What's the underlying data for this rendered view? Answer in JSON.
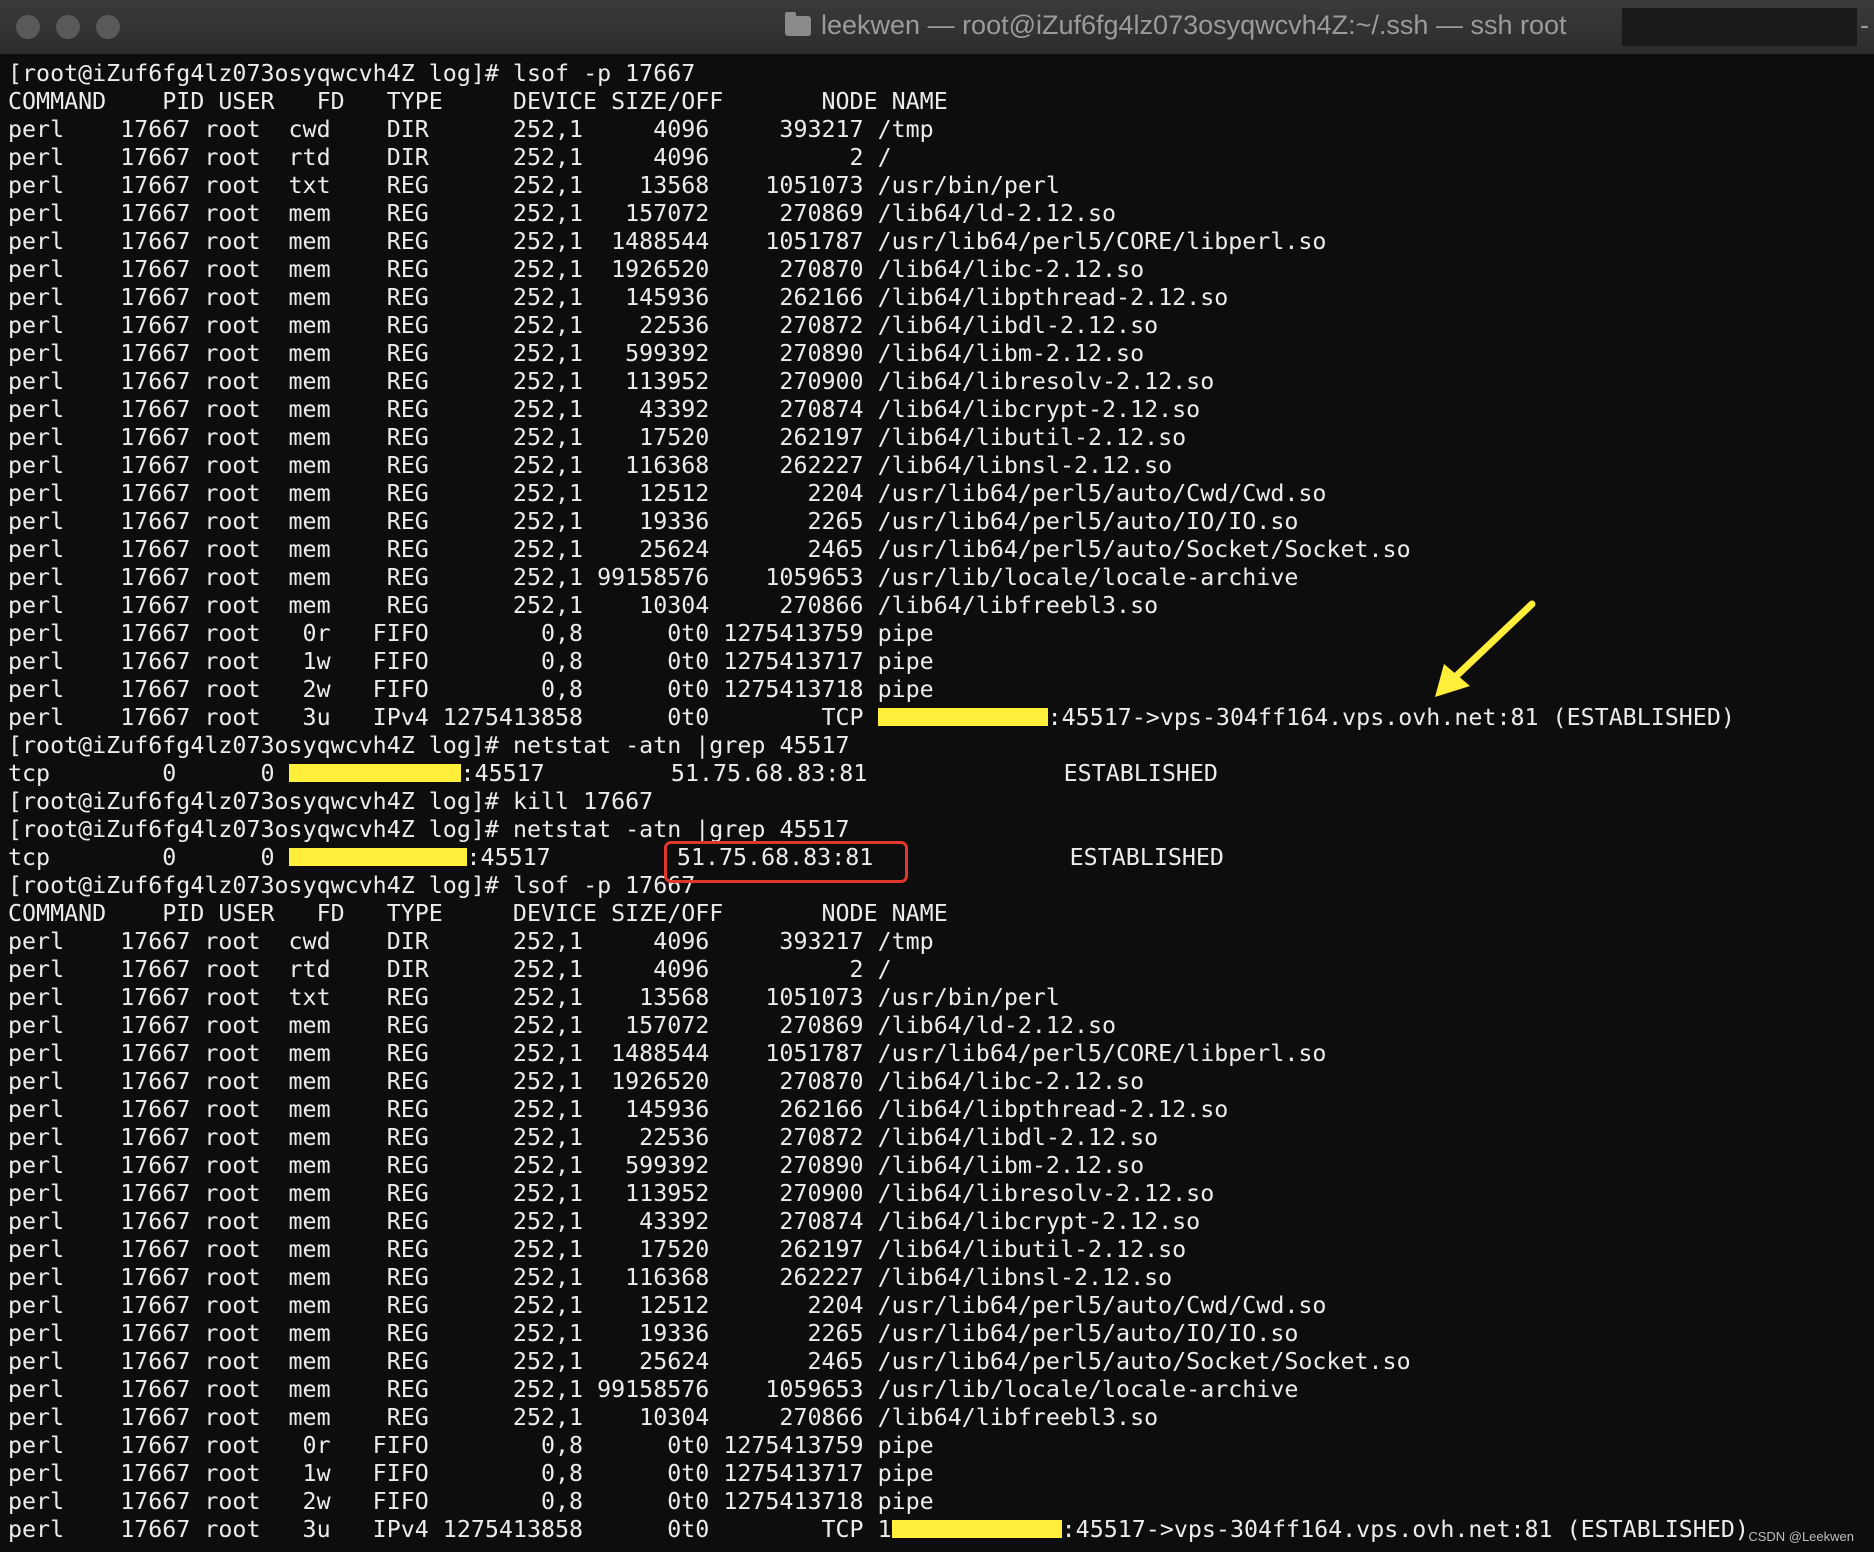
{
  "window": {
    "title": "leekwen — root@iZuf6fg4lz073osyqwcvh4Z:~/.ssh — ssh root",
    "title_trail": "-"
  },
  "colors": {
    "highlight": "#ffef3a",
    "annotation_box": "#e0372a",
    "arrow": "#ffef3a"
  },
  "icons": [
    "folder-icon",
    "arrow-icon"
  ],
  "terminal": {
    "prompt": "[root@iZuf6fg4lz073osyqwcvh4Z log]#",
    "block1": {
      "command": " lsof -p 17667",
      "header": "COMMAND    PID USER   FD   TYPE     DEVICE SIZE/OFF       NODE NAME",
      "rows": [
        "perl    17667 root  cwd    DIR      252,1     4096     393217 /tmp",
        "perl    17667 root  rtd    DIR      252,1     4096          2 /",
        "perl    17667 root  txt    REG      252,1    13568    1051073 /usr/bin/perl",
        "perl    17667 root  mem    REG      252,1   157072     270869 /lib64/ld-2.12.so",
        "perl    17667 root  mem    REG      252,1  1488544    1051787 /usr/lib64/perl5/CORE/libperl.so",
        "perl    17667 root  mem    REG      252,1  1926520     270870 /lib64/libc-2.12.so",
        "perl    17667 root  mem    REG      252,1   145936     262166 /lib64/libpthread-2.12.so",
        "perl    17667 root  mem    REG      252,1    22536     270872 /lib64/libdl-2.12.so",
        "perl    17667 root  mem    REG      252,1   599392     270890 /lib64/libm-2.12.so",
        "perl    17667 root  mem    REG      252,1   113952     270900 /lib64/libresolv-2.12.so",
        "perl    17667 root  mem    REG      252,1    43392     270874 /lib64/libcrypt-2.12.so",
        "perl    17667 root  mem    REG      252,1    17520     262197 /lib64/libutil-2.12.so",
        "perl    17667 root  mem    REG      252,1   116368     262227 /lib64/libnsl-2.12.so",
        "perl    17667 root  mem    REG      252,1    12512       2204 /usr/lib64/perl5/auto/Cwd/Cwd.so",
        "perl    17667 root  mem    REG      252,1    19336       2265 /usr/lib64/perl5/auto/IO/IO.so",
        "perl    17667 root  mem    REG      252,1    25624       2465 /usr/lib64/perl5/auto/Socket/Socket.so",
        "perl    17667 root  mem    REG      252,1 99158576    1059653 /usr/lib/locale/locale-archive",
        "perl    17667 root  mem    REG      252,1    10304     270866 /lib64/libfreebl3.so",
        "perl    17667 root   0r   FIFO        0,8      0t0 1275413759 pipe",
        "perl    17667 root   1w   FIFO        0,8      0t0 1275413717 pipe",
        "perl    17667 root   2w   FIFO        0,8      0t0 1275413718 pipe"
      ],
      "tcp_row_prefix": "perl    17667 root   3u   IPv4 1275413858      0t0        TCP ",
      "tcp_row_suffix": ":45517->vps-304ff164.vps.ovh.net:81 (ESTABLISHED)"
    },
    "netstat1": {
      "command": " netstat -atn |grep 45517",
      "prefix": "tcp        0      0 ",
      "suffix": ":45517         51.75.68.83:81              ESTABLISHED"
    },
    "kill": {
      "command": " kill 17667"
    },
    "netstat2": {
      "command": " netstat -atn |grep 45517",
      "prefix": "tcp        0      0 ",
      "port": ":45517",
      "gap": "         ",
      "foreign": "51.75.68.83:81",
      "state": "              ESTABLISHED"
    },
    "block2": {
      "command": " lsof -p 17667",
      "header": "COMMAND    PID USER   FD   TYPE     DEVICE SIZE/OFF       NODE NAME",
      "rows": [
        "perl    17667 root  cwd    DIR      252,1     4096     393217 /tmp",
        "perl    17667 root  rtd    DIR      252,1     4096          2 /",
        "perl    17667 root  txt    REG      252,1    13568    1051073 /usr/bin/perl",
        "perl    17667 root  mem    REG      252,1   157072     270869 /lib64/ld-2.12.so",
        "perl    17667 root  mem    REG      252,1  1488544    1051787 /usr/lib64/perl5/CORE/libperl.so",
        "perl    17667 root  mem    REG      252,1  1926520     270870 /lib64/libc-2.12.so",
        "perl    17667 root  mem    REG      252,1   145936     262166 /lib64/libpthread-2.12.so",
        "perl    17667 root  mem    REG      252,1    22536     270872 /lib64/libdl-2.12.so",
        "perl    17667 root  mem    REG      252,1   599392     270890 /lib64/libm-2.12.so",
        "perl    17667 root  mem    REG      252,1   113952     270900 /lib64/libresolv-2.12.so",
        "perl    17667 root  mem    REG      252,1    43392     270874 /lib64/libcrypt-2.12.so",
        "perl    17667 root  mem    REG      252,1    17520     262197 /lib64/libutil-2.12.so",
        "perl    17667 root  mem    REG      252,1   116368     262227 /lib64/libnsl-2.12.so",
        "perl    17667 root  mem    REG      252,1    12512       2204 /usr/lib64/perl5/auto/Cwd/Cwd.so",
        "perl    17667 root  mem    REG      252,1    19336       2265 /usr/lib64/perl5/auto/IO/IO.so",
        "perl    17667 root  mem    REG      252,1    25624       2465 /usr/lib64/perl5/auto/Socket/Socket.so",
        "perl    17667 root  mem    REG      252,1 99158576    1059653 /usr/lib/locale/locale-archive",
        "perl    17667 root  mem    REG      252,1    10304     270866 /lib64/libfreebl3.so",
        "perl    17667 root   0r   FIFO        0,8      0t0 1275413759 pipe",
        "perl    17667 root   1w   FIFO        0,8      0t0 1275413717 pipe",
        "perl    17667 root   2w   FIFO        0,8      0t0 1275413718 pipe"
      ],
      "tcp_row_prefix": "perl    17667 root   3u   IPv4 1275413858      0t0        TCP 1",
      "tcp_row_suffix": ":45517->vps-304ff164.vps.ovh.net:81 (ESTABLISHED)"
    }
  },
  "watermark": "CSDN @Leekwen"
}
